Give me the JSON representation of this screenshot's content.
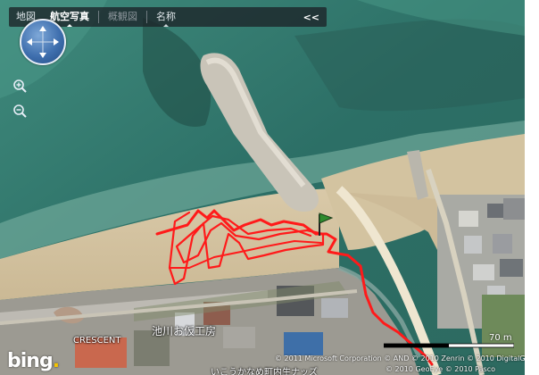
{
  "toolbar": {
    "items": [
      {
        "label": "地図",
        "state": "normal"
      },
      {
        "label": "航空写真",
        "state": "active"
      },
      {
        "label": "概観図",
        "state": "disabled"
      },
      {
        "label": "名称",
        "state": "named"
      }
    ],
    "collapse_label": "<<"
  },
  "map": {
    "labels": {
      "crescent": "CRESCENT",
      "place": "池川お仮工房",
      "bottom_text": "いこうかなめ町内生ナッズ"
    },
    "scale_label": "70 m",
    "logo": {
      "text": "bing",
      "dot": "."
    },
    "copyright_line1": "© 2011 Microsoft Corporation   © AND   © 2010 Zenrin   © 2010 DigitalGlobe",
    "copyright_line2": "© 2010 GeoEye   © 2010 Pasco",
    "track_color": "#ff1a1a",
    "flag_color": "#2e8b2e"
  },
  "icons": {
    "nav": "pan-compass-icon",
    "zoom_in": "zoom-in-icon",
    "zoom_out": "zoom-out-icon",
    "flag": "start-flag-icon"
  }
}
